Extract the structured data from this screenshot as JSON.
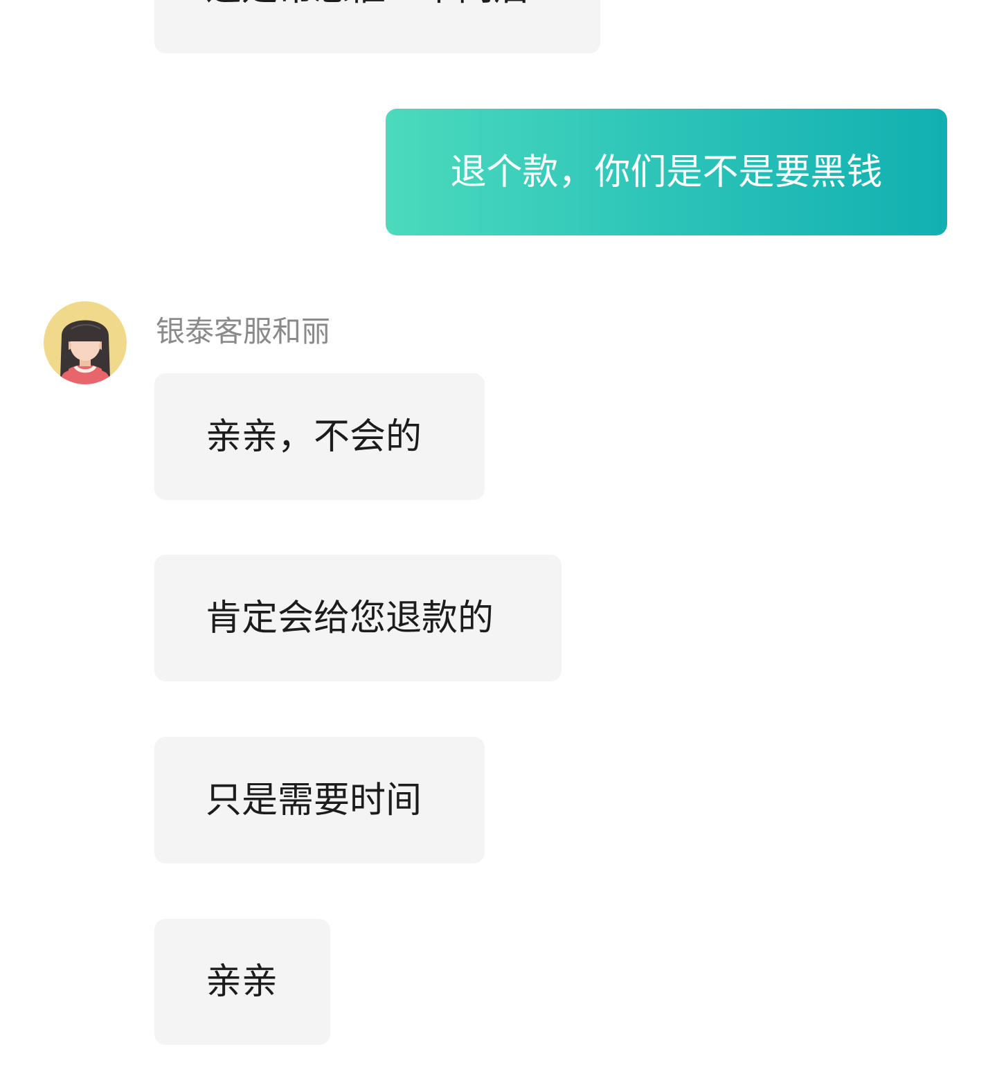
{
  "chat": {
    "messages": [
      {
        "role": "agent",
        "text": "这是常态催一下问后"
      },
      {
        "role": "user",
        "text": "退个款，你们是不是要黑钱"
      },
      {
        "role": "agent",
        "text": "亲亲，不会的"
      },
      {
        "role": "agent",
        "text": "肯定会给您退款的"
      },
      {
        "role": "agent",
        "text": "只是需要时间"
      },
      {
        "role": "agent",
        "text": "亲亲"
      }
    ],
    "agent": {
      "name": "银泰客服和丽",
      "avatar_icon": "girl-avatar-icon"
    }
  },
  "colors": {
    "agent_bubble": "#f4f4f4",
    "user_bubble_start": "#4cdabd",
    "user_bubble_end": "#12b0b1",
    "agent_name": "#8a8a8a",
    "text_dark": "#1c1c1c"
  }
}
